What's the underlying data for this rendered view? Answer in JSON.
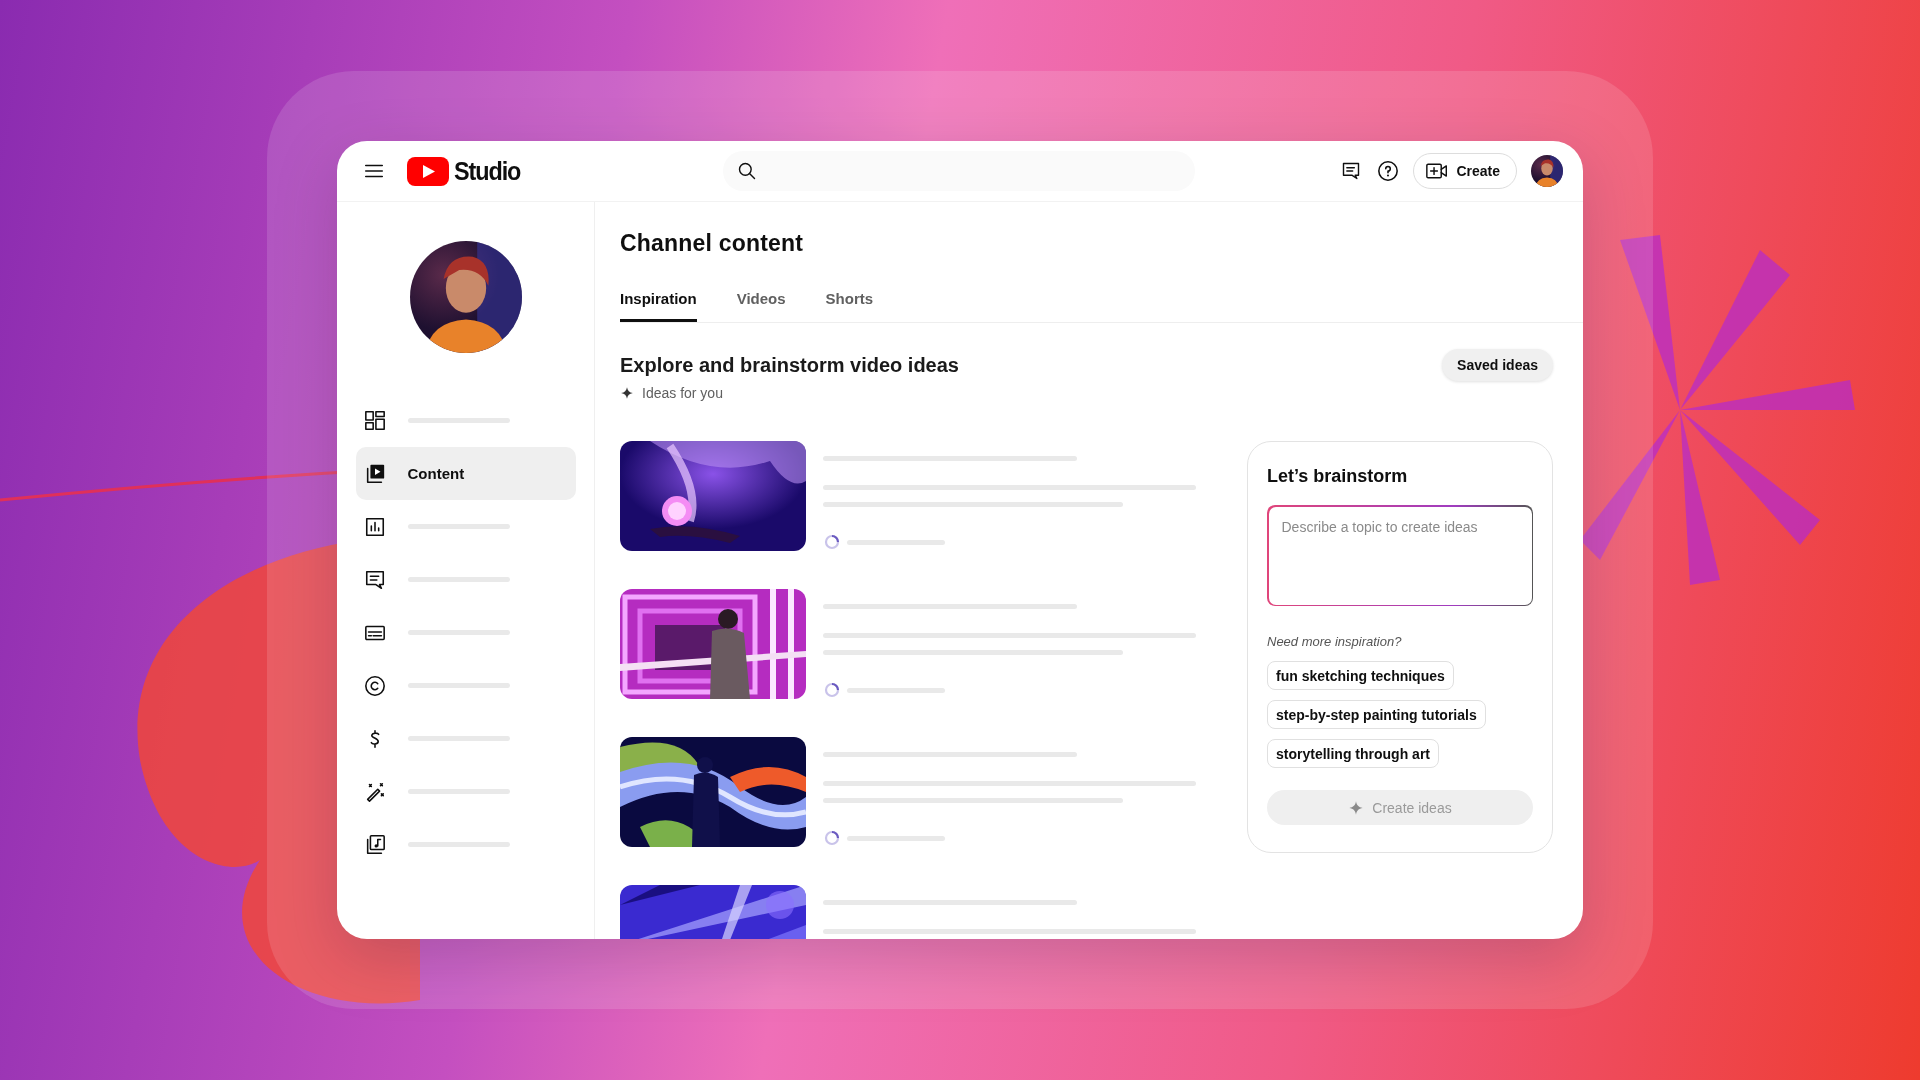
{
  "header": {
    "logo": {
      "text": "Studio"
    },
    "create_button": {
      "label": "Create"
    }
  },
  "sidebar": {
    "items": [
      {
        "kind": "placeholder",
        "selected": false
      },
      {
        "kind": "link",
        "label": "Content",
        "selected": true
      },
      {
        "kind": "placeholder",
        "selected": false
      },
      {
        "kind": "placeholder",
        "selected": false
      },
      {
        "kind": "placeholder",
        "selected": false
      },
      {
        "kind": "placeholder",
        "selected": false
      },
      {
        "kind": "placeholder",
        "selected": false
      },
      {
        "kind": "placeholder",
        "selected": false
      },
      {
        "kind": "placeholder",
        "selected": false
      }
    ]
  },
  "page": {
    "title": "Channel content",
    "tabs": [
      {
        "label": "Inspiration",
        "selected": true
      },
      {
        "label": "Videos",
        "selected": false
      },
      {
        "label": "Shorts",
        "selected": false
      }
    ]
  },
  "section": {
    "title": "Explore and brainstorm video ideas",
    "subtitle": "Ideas for you",
    "saved_button": {
      "label": "Saved ideas"
    }
  },
  "ideas": [
    {
      "loading": true
    },
    {
      "loading": true
    },
    {
      "loading": true
    },
    {
      "loading": true
    }
  ],
  "brainstorm": {
    "title": "Let’s brainstorm",
    "input": {
      "placeholder": "Describe a topic to create ideas"
    },
    "hint": "Need more inspiration?",
    "suggestions": [
      {
        "label": "fun sketching techniques"
      },
      {
        "label": "step-by-step painting tutorials"
      },
      {
        "label": "storytelling through art"
      }
    ],
    "create_button": {
      "label": "Create ideas",
      "disabled": true
    }
  }
}
